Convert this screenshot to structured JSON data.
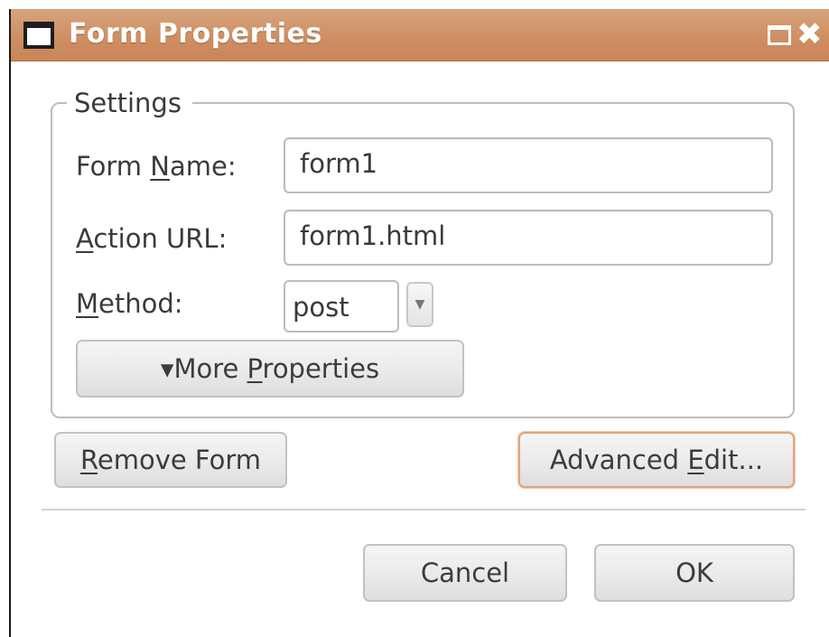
{
  "window": {
    "title": "Form Properties",
    "icons": {
      "app": "window-icon",
      "maximize": "maximize-icon",
      "close": "close-icon"
    },
    "close_glyph": "✖"
  },
  "settings": {
    "legend": "Settings",
    "form_name": {
      "label_pre": "Form ",
      "label_mnemonic": "N",
      "label_post": "ame:",
      "value": "form1"
    },
    "action_url": {
      "label_pre": "",
      "label_mnemonic": "A",
      "label_post": "ction URL:",
      "value": "form1.html"
    },
    "method": {
      "label_pre": "",
      "label_mnemonic": "M",
      "label_post": "ethod:",
      "value": "post",
      "arrow_glyph": "▼"
    },
    "more_properties": {
      "arrow_glyph": "▾",
      "label_pre": "More ",
      "label_mnemonic": "P",
      "label_post": "roperties"
    }
  },
  "actions": {
    "remove_form": {
      "label_pre": "",
      "label_mnemonic": "R",
      "label_post": "emove Form"
    },
    "advanced_edit": {
      "label_pre": "Advanced ",
      "label_mnemonic": "E",
      "label_post": "dit..."
    }
  },
  "footer": {
    "cancel_label": "Cancel",
    "ok_label": "OK"
  },
  "colors": {
    "titlebar": "#cf8f63",
    "focus_border": "#e2a47a",
    "frame_border": "#bdbdbd"
  }
}
